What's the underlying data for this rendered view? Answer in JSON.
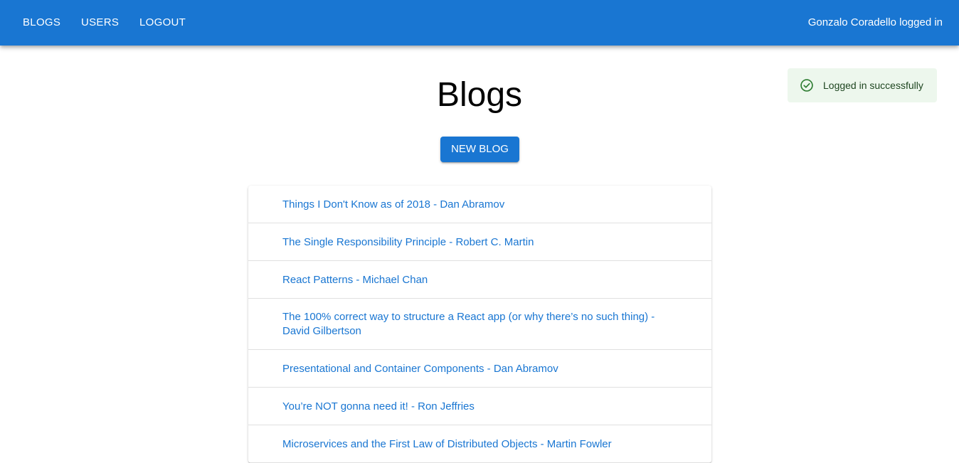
{
  "navbar": {
    "links": {
      "blogs": "BLOGS",
      "users": "USERS",
      "logout": "LOGOUT"
    },
    "user_status": "Gonzalo Coradello logged in"
  },
  "notification": {
    "icon": "check-circle-icon",
    "message": "Logged in successfully"
  },
  "main": {
    "title": "Blogs",
    "new_blog_label": "NEW BLOG",
    "blogs": [
      "Things I Don't Know as of 2018 - Dan Abramov",
      "The Single Responsibility Principle - Robert C. Martin",
      "React Patterns - Michael Chan",
      "The 100% correct way to structure a React app (or why there’s no such thing) - David Gilbertson",
      "Presentational and Container Components - Dan Abramov",
      "You’re NOT gonna need it! - Ron Jeffries",
      "Microservices and the First Law of Distributed Objects - Martin Fowler"
    ]
  },
  "colors": {
    "primary": "#1976d2",
    "alert_background": "#edf7ed",
    "alert_text": "#1e4620",
    "alert_icon": "#2e7d32"
  }
}
